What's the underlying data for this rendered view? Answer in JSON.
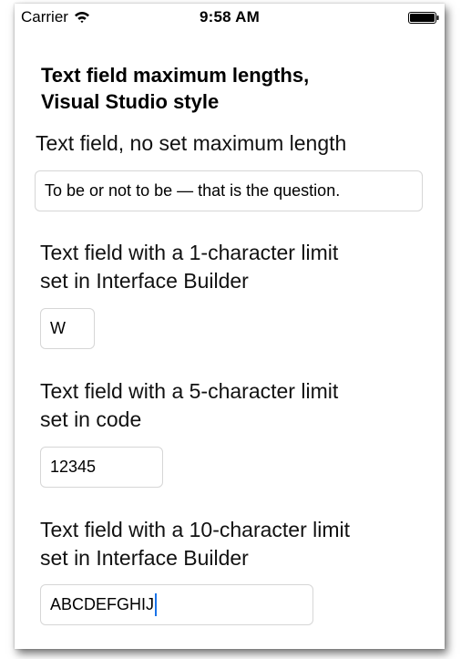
{
  "status_bar": {
    "carrier": "Carrier",
    "time": "9:58 AM",
    "wifi_icon": "wifi-icon",
    "battery_icon": "battery-full-icon"
  },
  "title_line1": "Text field maximum lengths,",
  "title_line2": "Visual Studio style",
  "fields": [
    {
      "label_lines": [
        "Text field, no set maximum length"
      ],
      "value": "To be or not to be — that is the question."
    },
    {
      "label_lines": [
        "Text field with a 1-character limit",
        "set in Interface Builder"
      ],
      "value": "W"
    },
    {
      "label_lines": [
        "Text field with a 5-character limit",
        "set in code"
      ],
      "value": "12345"
    },
    {
      "label_lines": [
        "Text field with a 10-character limit",
        "set in Interface Builder"
      ],
      "value": "ABCDEFGHIJ"
    }
  ],
  "colors": {
    "cursor": "#1a73e8",
    "field_border": "#d6d6d6"
  }
}
